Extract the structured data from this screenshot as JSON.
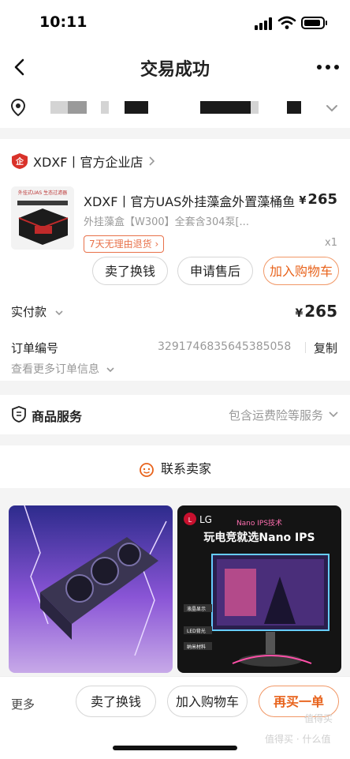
{
  "status": {
    "time": "10:11"
  },
  "nav": {
    "title": "交易成功"
  },
  "order": {
    "shop_name": "XDXF丨官方企业店",
    "product_title": "XDXF丨官方UAS外挂藻盒外置藻桶鱼",
    "currency": "¥",
    "price": "265",
    "variant": "外挂藻盒【W300】全套含304泵[...",
    "return_tag": "7天无理由退货",
    "quantity": "x1",
    "thumb_text": "外挂式UAS 生态过滤器",
    "buttons": [
      "卖了换钱",
      "申请售后",
      "加入购物车"
    ],
    "paid_label": "实付款",
    "paid_amount": "265",
    "order_no_label": "订单编号",
    "order_no": "3291746835645385058",
    "copy": "复制",
    "more_info": "查看更多订单信息"
  },
  "service": {
    "label": "商品服务",
    "value": "包含运费险等服务"
  },
  "contact": {
    "label": "联系卖家"
  },
  "ads": {
    "right_brand": "LG",
    "right_tag": "Nano IPS技术",
    "right_headline": "玩电竞就选Nano IPS",
    "right_bullets": [
      "液晶显示",
      "LED背光",
      "纳米材料"
    ]
  },
  "bottom": {
    "more": "更多",
    "buttons": [
      "卖了换钱",
      "加入购物车",
      "再买一单"
    ],
    "watermark_1": "值得买",
    "watermark_2": "值得买 · 什么值"
  },
  "colors": {
    "accent": "#e8631c",
    "tag": "#e8714a",
    "shop_badge": "#d9322a"
  }
}
